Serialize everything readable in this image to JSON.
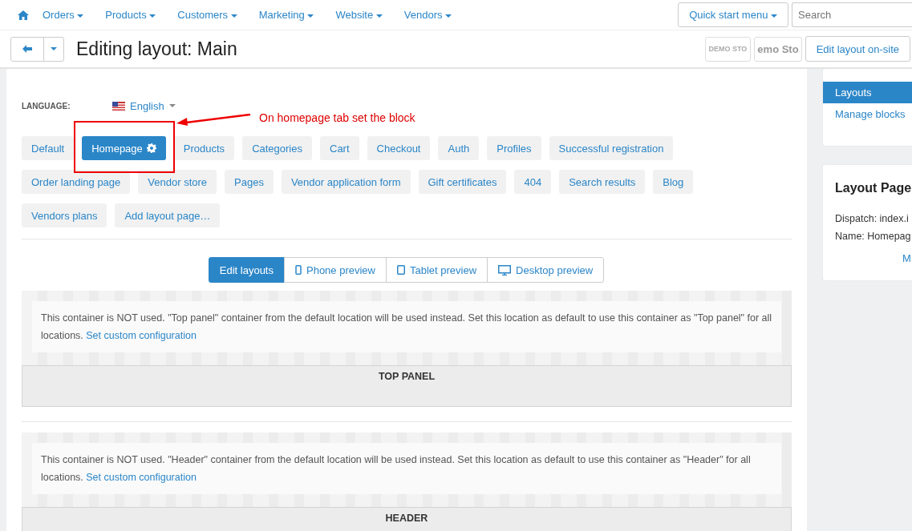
{
  "top_nav": {
    "items": [
      "Orders",
      "Products",
      "Customers",
      "Marketing",
      "Website",
      "Vendors"
    ],
    "quick_start": "Quick start menu",
    "search": {
      "placeholder": "Search"
    }
  },
  "header": {
    "title": "Editing layout: Main",
    "logos": [
      "DEMO STO",
      "emo Sto"
    ],
    "edit_on_site": "Edit layout on-site"
  },
  "language": {
    "label": "LANGUAGE:",
    "value": "English"
  },
  "annotation": {
    "text": "On homepage tab set the block"
  },
  "layout_tabs": [
    {
      "label": "Default",
      "selected": false
    },
    {
      "label": "Homepage",
      "selected": true
    },
    {
      "label": "Products",
      "selected": false
    },
    {
      "label": "Categories",
      "selected": false
    },
    {
      "label": "Cart",
      "selected": false
    },
    {
      "label": "Checkout",
      "selected": false
    },
    {
      "label": "Auth",
      "selected": false
    },
    {
      "label": "Profiles",
      "selected": false
    },
    {
      "label": "Successful registration",
      "selected": false
    },
    {
      "label": "Order landing page",
      "selected": false
    },
    {
      "label": "Vendor store",
      "selected": false
    },
    {
      "label": "Pages",
      "selected": false
    },
    {
      "label": "Vendor application form",
      "selected": false
    },
    {
      "label": "Gift certificates",
      "selected": false
    },
    {
      "label": "404",
      "selected": false
    },
    {
      "label": "Search results",
      "selected": false
    },
    {
      "label": "Blog",
      "selected": false
    },
    {
      "label": "Vendors plans",
      "selected": false
    },
    {
      "label": "Add layout page…",
      "selected": false
    }
  ],
  "view_modes": [
    {
      "label": "Edit layouts",
      "kind": "edit",
      "selected": true
    },
    {
      "label": "Phone preview",
      "kind": "phone",
      "selected": false
    },
    {
      "label": "Tablet preview",
      "kind": "tablet",
      "selected": false
    },
    {
      "label": "Desktop preview",
      "kind": "desktop",
      "selected": false
    }
  ],
  "containers": [
    {
      "notice": "This container is NOT used. \"Top panel\" container from the default location will be used instead. Set this location as default to use this container as \"Top panel\" for all locations.",
      "link": "Set custom configuration",
      "title": "TOP PANEL"
    },
    {
      "notice": "This container is NOT used. \"Header\" container from the default location will be used instead. Set this location as default to use this container as \"Header\" for all locations.",
      "link": "Set custom configuration",
      "title": "HEADER"
    }
  ],
  "sidebar": {
    "nav": [
      {
        "label": "Layouts",
        "selected": true
      },
      {
        "label": "Manage blocks",
        "selected": false
      }
    ],
    "card": {
      "title": "Layout Page",
      "lines": [
        "Dispatch: index.i",
        "Name: Homepag"
      ],
      "link": "M"
    }
  }
}
